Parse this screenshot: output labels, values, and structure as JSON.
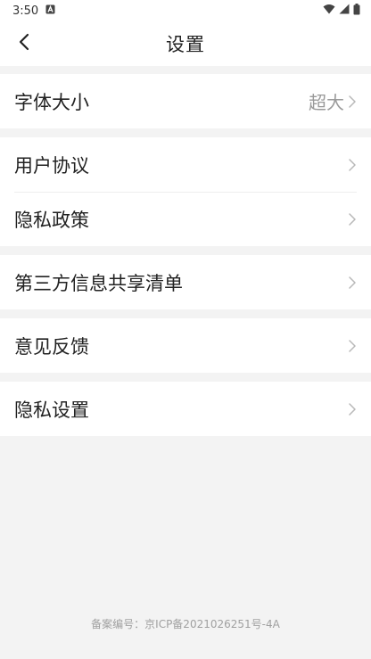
{
  "status_bar": {
    "time": "3:50",
    "icons": [
      "notification-a-icon",
      "wifi-icon",
      "signal-icon",
      "battery-icon"
    ]
  },
  "header": {
    "title": "设置",
    "back_icon": "chevron-left-icon"
  },
  "settings": {
    "font_size": {
      "label": "字体大小",
      "value": "超大"
    },
    "user_agreement": {
      "label": "用户协议"
    },
    "privacy_policy": {
      "label": "隐私政策"
    },
    "third_party_list": {
      "label": "第三方信息共享清单"
    },
    "feedback": {
      "label": "意见反馈"
    },
    "privacy_settings": {
      "label": "隐私设置"
    }
  },
  "footer": {
    "icp": "备案编号：京ICP备2021026251号-4A"
  }
}
